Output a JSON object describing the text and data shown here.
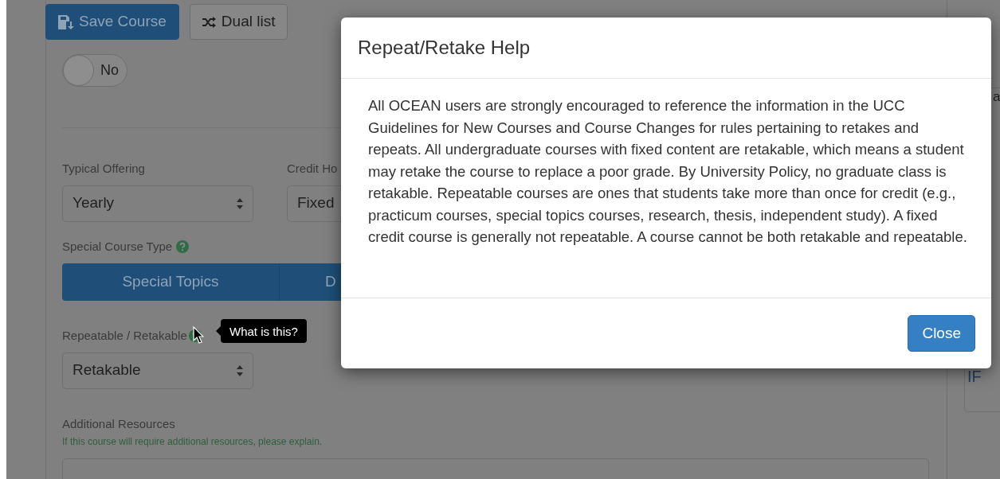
{
  "toolbar": {
    "buttons": [
      {
        "label": "Save Course",
        "kind": "primary"
      },
      {
        "label": "Dual list",
        "kind": "default"
      }
    ]
  },
  "toggle": {
    "label": "No",
    "on": false
  },
  "typical_offering": {
    "label": "Typical Offering",
    "value": "Yearly"
  },
  "credit_hours": {
    "label": "Credit Ho",
    "value": "Fixed"
  },
  "special_course_type": {
    "label": "Special Course Type",
    "options": [
      "Special Topics",
      "D"
    ]
  },
  "repeatable": {
    "label": "Repeatable / Retakable",
    "value": "Retakable",
    "tooltip": "What is this?"
  },
  "additional_resources": {
    "label": "Additional Resources",
    "hint": "If this course will require additional resources, please explain."
  },
  "side_panel": {
    "texts": [
      "a",
      "IF"
    ]
  },
  "modal": {
    "title": "Repeat/Retake Help",
    "body": "All OCEAN users are strongly encouraged to reference the information in the UCC Guidelines for New Courses and Course Changes for rules pertaining to retakes and repeats. All undergraduate courses with fixed content are retakable, which means a student may retake the course to replace a poor grade. By University Policy, no graduate class is retakable. Repeatable courses are ones that students take more than once for credit (e.g., practicum courses, special topics courses, research, thesis, independent study). A fixed credit course is generally not repeatable. A course cannot be both retakable and repeatable.",
    "buttons": [
      "Close"
    ]
  }
}
